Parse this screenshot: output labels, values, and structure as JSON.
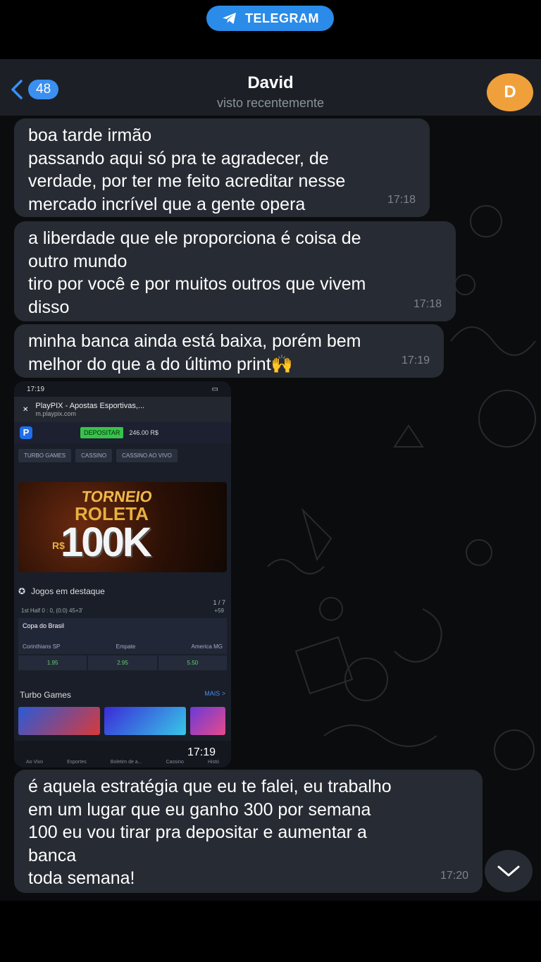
{
  "top_badge": {
    "label": "TELEGRAM"
  },
  "header": {
    "unread_count": "48",
    "contact_name": "David",
    "status": "visto recentemente",
    "avatar_initial": "D"
  },
  "messages": [
    {
      "lines": [
        "boa tarde irmão",
        "passando aqui só pra te agradecer, de",
        "verdade, por ter me feito acreditar nesse",
        "mercado incrível que a gente opera"
      ],
      "time": "17:18"
    },
    {
      "lines": [
        "a liberdade que ele proporciona é coisa de",
        "outro mundo",
        "tiro por você e por muitos outros que vivem",
        "disso"
      ],
      "time": "17:18"
    },
    {
      "lines": [
        "minha banca ainda está baixa, porém bem",
        "melhor do que a do último print🙌"
      ],
      "time": "17:19"
    },
    {
      "lines": [
        "é aquela estratégia que eu te falei, eu trabalho",
        "em um lugar que eu ganho 300 por semana",
        "100 eu vou tirar pra depositar e aumentar a",
        "banca",
        "toda semana!"
      ],
      "time": "17:20"
    }
  ],
  "screenshot": {
    "time_label": "17:19",
    "phone_status_time": "17:19",
    "url_title": "PlayPIX - Apostas Esportivas,...",
    "url_domain": "m.playpix.com",
    "deposit_label": "DEPOSITAR",
    "balance": "246.00 R$",
    "tabs": [
      "TURBO GAMES",
      "CASSINO",
      "CASSINO AO VIVO"
    ],
    "banner": {
      "line1": "TORNEIO",
      "line2": "ROLETA",
      "amount": "100K",
      "currency": "R$"
    },
    "featured_title": "Jogos em destaque",
    "pager": "1 / 7",
    "live_info": "1st Half  0 : 0, (0:0) 45+3'",
    "live_markets": "+59",
    "competition": "Copa do Brasil",
    "team_home": "Corinthians SP",
    "draw_label": "Empate",
    "team_away": "America MG",
    "odds": [
      "1.95",
      "2.95",
      "5.50"
    ],
    "turbo_title": "Turbo Games",
    "more_label": "MAIS >",
    "nav": [
      "Ao Vivo",
      "Esportes",
      "Boletim de a...",
      "Cassino",
      "Histó"
    ]
  }
}
